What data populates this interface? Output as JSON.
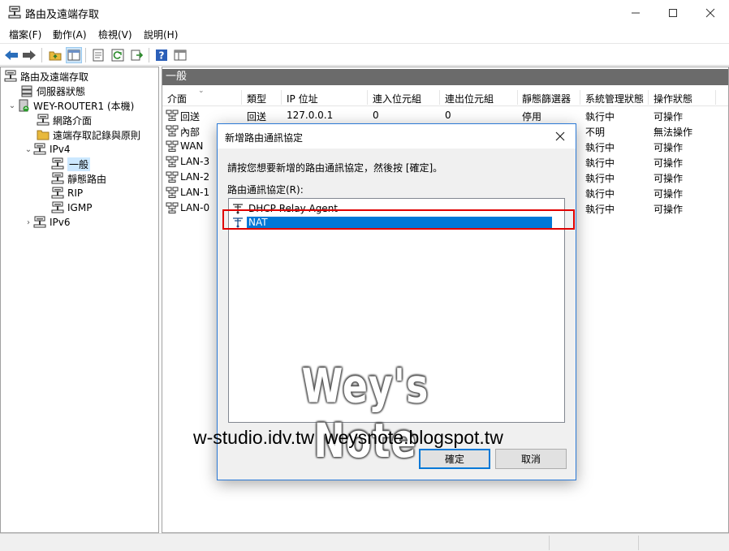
{
  "window": {
    "title": "路由及遠端存取",
    "controls": [
      "minimize-icon",
      "maximize-icon",
      "close-icon"
    ]
  },
  "menu": [
    "檔案(F)",
    "動作(A)",
    "檢視(V)",
    "說明(H)"
  ],
  "toolbar": {
    "buttons": [
      "back-arrow-icon",
      "forward-arrow-icon",
      "up-folder-icon",
      "show-tree-icon",
      "properties-icon",
      "refresh-icon",
      "export-icon",
      "help-icon",
      "console-icon"
    ]
  },
  "tree": {
    "root": "路由及遠端存取",
    "server_status": "伺服器狀態",
    "server": "WEY-ROUTER1 (本機)",
    "network_interfaces": "網路介面",
    "remote_access_logs": "遠端存取記錄與原則",
    "ipv4": "IPv4",
    "general": "一般",
    "static_routes": "靜態路由",
    "rip": "RIP",
    "igmp": "IGMP",
    "ipv6": "IPv6"
  },
  "pane": {
    "header": "一般",
    "columns": [
      "介面",
      "類型",
      "IP 位址",
      "連入位元組",
      "連出位元組",
      "靜態篩選器",
      "系統管理狀態",
      "操作狀態"
    ],
    "rows": [
      {
        "name": "回送",
        "type": "回送",
        "ip": "127.0.0.1",
        "in": "0",
        "out": "0",
        "filter": "停用",
        "admin": "執行中",
        "oper": "可操作"
      },
      {
        "name": "內部",
        "type": "",
        "ip": "",
        "in": "",
        "out": "",
        "filter": "",
        "admin": "不明",
        "oper": "無法操作"
      },
      {
        "name": "WAN",
        "type": "",
        "ip": "",
        "in": "",
        "out": "",
        "filter": "",
        "admin": "執行中",
        "oper": "可操作"
      },
      {
        "name": "LAN-3",
        "type": "",
        "ip": "",
        "in": "",
        "out": "",
        "filter": "",
        "admin": "執行中",
        "oper": "可操作"
      },
      {
        "name": "LAN-2",
        "type": "",
        "ip": "",
        "in": "",
        "out": "",
        "filter": "",
        "admin": "執行中",
        "oper": "可操作"
      },
      {
        "name": "LAN-1",
        "type": "",
        "ip": "",
        "in": "",
        "out": "",
        "filter": "",
        "admin": "執行中",
        "oper": "可操作"
      },
      {
        "name": "LAN-0",
        "type": "",
        "ip": "",
        "in": "",
        "out": "",
        "filter": "",
        "admin": "執行中",
        "oper": "可操作"
      }
    ]
  },
  "dialog": {
    "title": "新增路由通訊協定",
    "instruction": "請按您想要新增的路由通訊協定，然後按 [確定]。",
    "list_label": "路由通訊協定(R):",
    "protocols": [
      "DHCP Relay Agent",
      "NAT"
    ],
    "selected": "NAT",
    "ok": "確定",
    "cancel": "取消"
  },
  "watermark": {
    "title": "Wey's Note",
    "urls": "w-studio.idv.tw  weysnote.blogspot.tw"
  },
  "colors": {
    "selection": "#0078d7",
    "tree_selection": "#cce8ff",
    "pane_header": "#6b6b6b",
    "highlight_box": "#e00000"
  }
}
